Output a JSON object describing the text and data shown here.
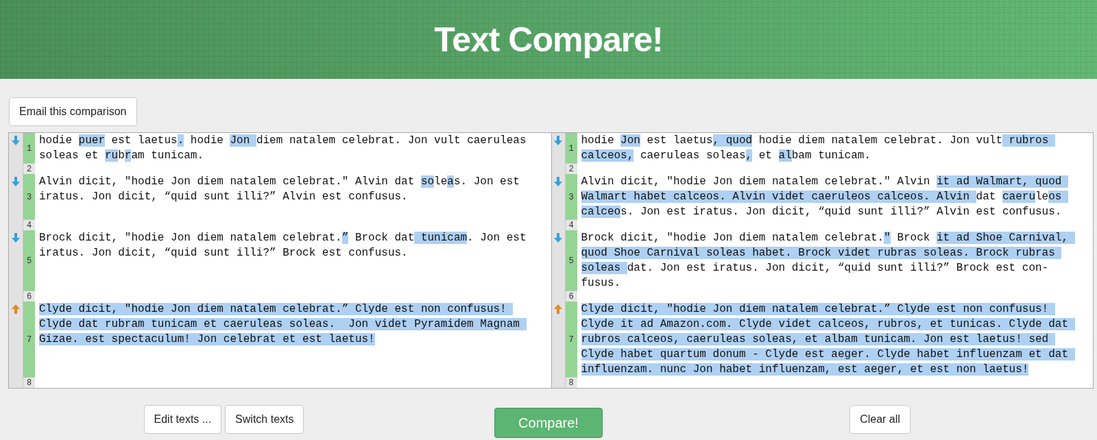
{
  "header": {
    "title": "Text Compare!"
  },
  "email_button": "Email this comparison",
  "left": {
    "lines": [
      {
        "number": "1",
        "kind": "down",
        "changed": true,
        "segments": [
          {
            "text": "hodie ",
            "changed": false
          },
          {
            "text": "puer",
            "changed": true
          },
          {
            "text": " est laetus",
            "changed": false
          },
          {
            "text": ".",
            "changed": true
          },
          {
            "text": " hodie ",
            "changed": false
          },
          {
            "text": "Jon ",
            "changed": true
          },
          {
            "text": "diem natalem celebrat. Jon vult caeruleas soleas et ",
            "changed": false
          },
          {
            "text": "ru",
            "changed": true
          },
          {
            "text": "b",
            "changed": false
          },
          {
            "text": "r",
            "changed": true
          },
          {
            "text": "am tunicam.",
            "changed": false
          }
        ]
      },
      {
        "number": "2",
        "changed": false
      },
      {
        "number": "3",
        "kind": "down",
        "changed": true,
        "segments": [
          {
            "text": "Alvin dicit, \"hodie Jon diem natalem celebrat.\" Alvin dat ",
            "changed": false
          },
          {
            "text": "so",
            "changed": true
          },
          {
            "text": "le",
            "changed": false
          },
          {
            "text": "a",
            "changed": true
          },
          {
            "text": "s. Jon est iratus. Jon dicit, “quid sunt illi?” Alvin est confusus.",
            "changed": false
          }
        ]
      },
      {
        "number": "4",
        "changed": false
      },
      {
        "number": "5",
        "kind": "down",
        "changed": true,
        "segments": [
          {
            "text": "Brock dicit, \"hodie Jon diem natalem celebrat.",
            "changed": false
          },
          {
            "text": "”",
            "changed": true
          },
          {
            "text": " Brock dat",
            "changed": false
          },
          {
            "text": " tunicam",
            "changed": true
          },
          {
            "text": ". Jon est iratus. Jon dicit, “quid sunt illi?” Brock est confusus.",
            "changed": false
          }
        ]
      },
      {
        "number": "6",
        "changed": false
      },
      {
        "number": "7",
        "kind": "up",
        "changed": true,
        "segments": [
          {
            "text": "Clyde dicit, \"hodie Jon diem natalem celebrat.” Clyde est non confusus! Clyde dat rubram tunicam et caeruleas soleas.  Jon videt Pyramidem Magnam Gizae. est spectaculum! Jon celebrat et est laetus!",
            "changed": true
          }
        ]
      },
      {
        "number": "8",
        "changed": false
      }
    ]
  },
  "right": {
    "lines": [
      {
        "number": "1",
        "kind": "down",
        "changed": true,
        "segments": [
          {
            "text": "hodie ",
            "changed": false
          },
          {
            "text": "Jon",
            "changed": true
          },
          {
            "text": " est laetus",
            "changed": false
          },
          {
            "text": ", quod",
            "changed": true
          },
          {
            "text": " hodie diem natalem celebrat. Jon vult",
            "changed": false
          },
          {
            "text": " rubros calceos,",
            "changed": true
          },
          {
            "text": " caeruleas soleas",
            "changed": false
          },
          {
            "text": ",",
            "changed": true
          },
          {
            "text": " et ",
            "changed": false
          },
          {
            "text": "al",
            "changed": true
          },
          {
            "text": "bam tunicam.",
            "changed": false
          }
        ]
      },
      {
        "number": "2",
        "changed": false
      },
      {
        "number": "3",
        "kind": "down",
        "changed": true,
        "segments": [
          {
            "text": "Alvin dicit, \"hodie Jon diem natalem celebrat.\" Alvin ",
            "changed": false
          },
          {
            "text": "it ad Walmart, quod Walmart habet calceos. Alvin videt caeruleos calceos. Alvin ",
            "changed": true
          },
          {
            "text": "dat ",
            "changed": false
          },
          {
            "text": "caeru",
            "changed": true
          },
          {
            "text": "le",
            "changed": false
          },
          {
            "text": "os calceo",
            "changed": true
          },
          {
            "text": "s. Jon est iratus. Jon dicit, “quid sunt illi?” Alvin est confusus.",
            "changed": false
          }
        ]
      },
      {
        "number": "4",
        "changed": false
      },
      {
        "number": "5",
        "kind": "down",
        "changed": true,
        "segments": [
          {
            "text": "Brock dicit, \"hodie Jon diem natalem celebrat.",
            "changed": false
          },
          {
            "text": "\"",
            "changed": true
          },
          {
            "text": " Brock ",
            "changed": false
          },
          {
            "text": "it ad Shoe Carnival, quod Shoe Carnival soleas habet. Brock videt rubras soleas. Brock rubras soleas ",
            "changed": true
          },
          {
            "text": "dat. Jon est iratus. Jon dicit, “quid sunt illi?” Brock est con-fusus.",
            "changed": false
          }
        ]
      },
      {
        "number": "6",
        "changed": false
      },
      {
        "number": "7",
        "kind": "up",
        "changed": true,
        "segments": [
          {
            "text": "Clyde dicit, \"hodie Jon diem natalem celebrat.” Clyde est non confusus! Clyde it ad Amazon.com. Clyde videt calceos, rubros, et tunicas. Clyde dat rubros calceos, caeruleas soleas, et albam tunicam. Jon est laetus! sed Clyde habet quartum donum - Clyde est aeger. Clyde habet influenzam et dat influenzam. nunc Jon habet influenzam, est aeger, et est non laetus!",
            "changed": true
          }
        ]
      },
      {
        "number": "8",
        "changed": false
      }
    ]
  },
  "actions": {
    "edit": "Edit texts ...",
    "switch": "Switch texts",
    "compare": "Compare!",
    "clear": "Clear all"
  }
}
